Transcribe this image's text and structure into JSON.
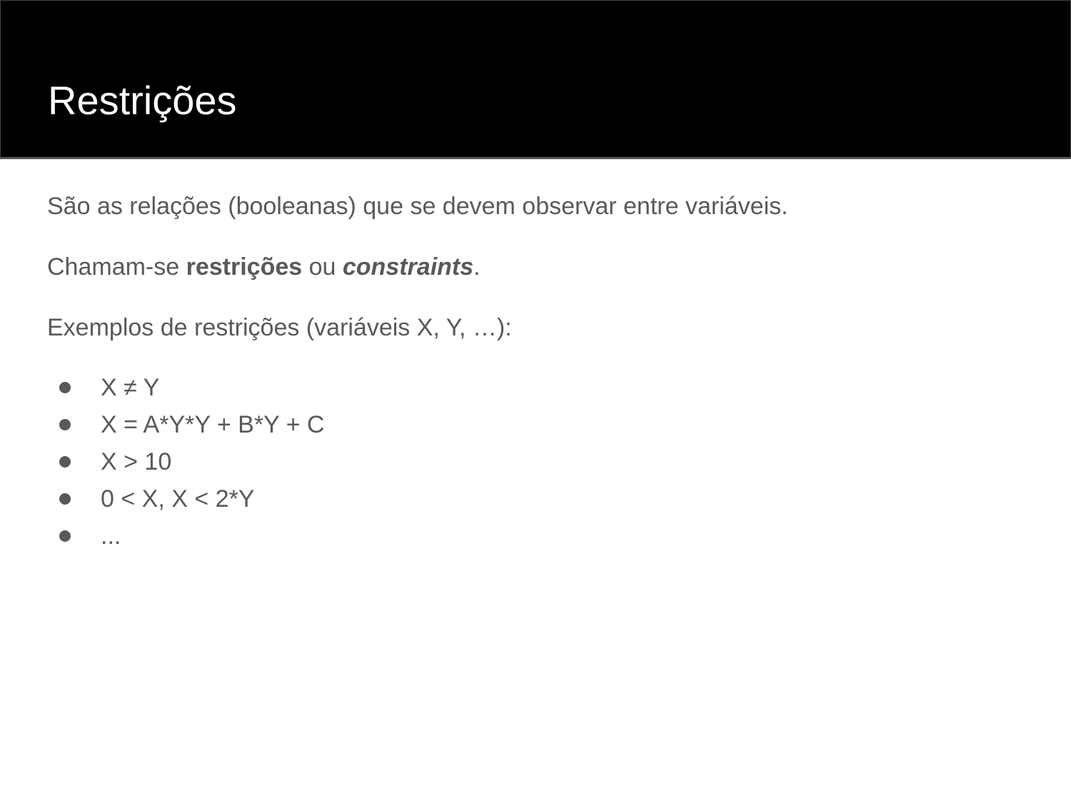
{
  "slide": {
    "title": "Restrições",
    "intro": "São as relações (booleanas) que se devem observar entre variáveis.",
    "naming": {
      "prefix": "Chamam-se ",
      "bold": "restrições",
      "middle": " ou ",
      "bold_italic": "constraints",
      "suffix": "."
    },
    "examples_heading": "Exemplos de restrições (variáveis X, Y, …):",
    "examples": [
      "X ≠ Y",
      "X = A*Y*Y + B*Y + C",
      "X > 10",
      "0 < X, X < 2*Y",
      "..."
    ]
  }
}
